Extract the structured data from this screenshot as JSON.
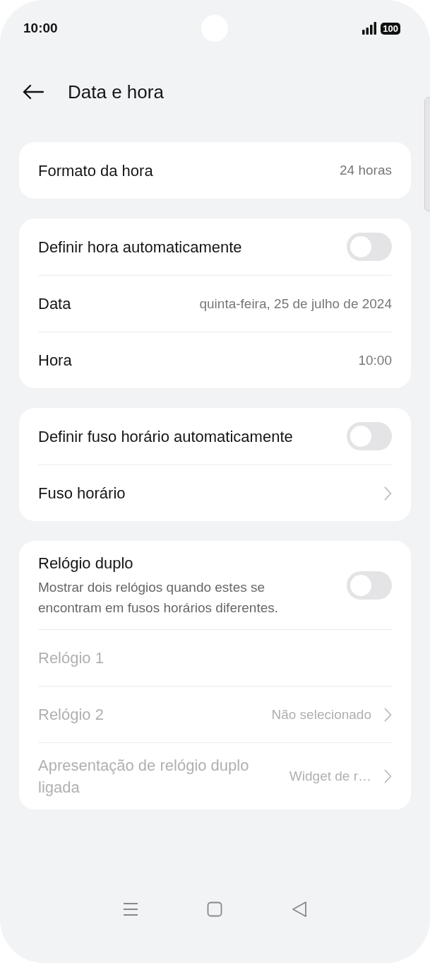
{
  "status_bar": {
    "time": "10:00",
    "battery": "100"
  },
  "header": {
    "title": "Data e hora"
  },
  "groups": [
    {
      "rows": [
        {
          "kind": "value",
          "label": "Formato da hora",
          "value": "24 horas",
          "disabled": false
        }
      ]
    },
    {
      "rows": [
        {
          "kind": "toggle",
          "label": "Definir hora automaticamente",
          "on": false,
          "disabled": false
        },
        {
          "kind": "value",
          "label": "Data",
          "value": "quinta-feira, 25 de julho de 2024",
          "disabled": false
        },
        {
          "kind": "value",
          "label": "Hora",
          "value": "10:00",
          "disabled": false
        }
      ]
    },
    {
      "rows": [
        {
          "kind": "toggle",
          "label": "Definir fuso horário automaticamente",
          "on": false,
          "disabled": false
        },
        {
          "kind": "chevron",
          "label": "Fuso horário",
          "disabled": false
        }
      ]
    },
    {
      "rows": [
        {
          "kind": "toggle",
          "label": "Relógio duplo",
          "description": "Mostrar dois relógios quando estes se encontram em fusos horários diferentes.",
          "on": false,
          "disabled": false
        },
        {
          "kind": "value",
          "label": "Relógio 1",
          "disabled": true
        },
        {
          "kind": "chevron",
          "label": "Relógio 2",
          "value": "Não selecionado",
          "disabled": true
        },
        {
          "kind": "chevron",
          "label": "Apresentação de relógio duplo ligada",
          "value": "Widget de r…",
          "disabled": true
        }
      ]
    }
  ]
}
